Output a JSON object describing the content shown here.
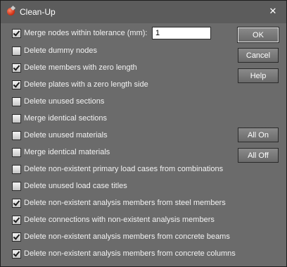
{
  "window": {
    "title": "Clean-Up",
    "close_glyph": "✕"
  },
  "tolerance": {
    "label": "Merge nodes within tolerance (mm):",
    "value": "1",
    "checked": true
  },
  "options": [
    {
      "label": "Delete dummy nodes",
      "checked": false
    },
    {
      "label": "Delete members with zero length",
      "checked": true
    },
    {
      "label": "Delete plates with a zero length side",
      "checked": true
    },
    {
      "label": "Delete unused sections",
      "checked": false
    },
    {
      "label": "Merge identical sections",
      "checked": false
    },
    {
      "label": "Delete unused materials",
      "checked": false
    },
    {
      "label": "Merge identical materials",
      "checked": false
    },
    {
      "label": "Delete non-existent primary load cases from combinations",
      "checked": false
    },
    {
      "label": "Delete unused load case titles",
      "checked": false
    },
    {
      "label": "Delete non-existent analysis members from steel members",
      "checked": true
    },
    {
      "label": "Delete connections with non-existent analysis members",
      "checked": true
    },
    {
      "label": "Delete non-existent analysis members from concrete beams",
      "checked": true
    },
    {
      "label": "Delete non-existent analysis members from concrete columns",
      "checked": true
    }
  ],
  "buttons": {
    "ok": "OK",
    "cancel": "Cancel",
    "help": "Help",
    "all_on": "All On",
    "all_off": "All Off"
  },
  "colors": {
    "dialog_bg": "#6b6b6b",
    "titlebar_bg": "#5c5c5c",
    "text": "#f2f2f2"
  }
}
